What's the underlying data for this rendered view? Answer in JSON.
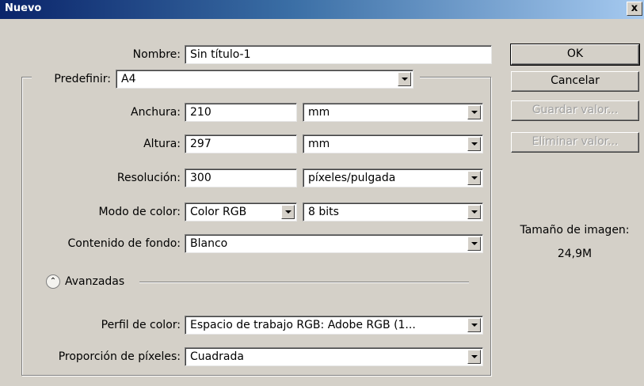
{
  "window": {
    "title": "Nuevo",
    "close_glyph": "x"
  },
  "form": {
    "name": {
      "label": "Nombre:",
      "value": "Sin título-1"
    },
    "preset": {
      "label": "Predefinir:",
      "value": "A4"
    },
    "width": {
      "label": "Anchura:",
      "value": "210",
      "unit": "mm"
    },
    "height": {
      "label": "Altura:",
      "value": "297",
      "unit": "mm"
    },
    "resolution": {
      "label": "Resolución:",
      "value": "300",
      "unit": "píxeles/pulgada"
    },
    "color_mode": {
      "label": "Modo de color:",
      "value": "Color RGB",
      "depth": "8 bits"
    },
    "background": {
      "label": "Contenido de fondo:",
      "value": "Blanco"
    },
    "advanced": {
      "label": "Avanzadas",
      "icon": "collapse-chevron-icon"
    },
    "color_profile": {
      "label": "Perfil de color:",
      "value": "Espacio de trabajo RGB: Adobe RGB (1..."
    },
    "pixel_aspect": {
      "label": "Proporción de píxeles:",
      "value": "Cuadrada"
    }
  },
  "buttons": {
    "ok": "OK",
    "cancel": "Cancelar",
    "save_preset": "Guardar valor...",
    "delete_preset": "Eliminar valor..."
  },
  "image_size": {
    "label": "Tamaño de imagen:",
    "value": "24,9M"
  }
}
